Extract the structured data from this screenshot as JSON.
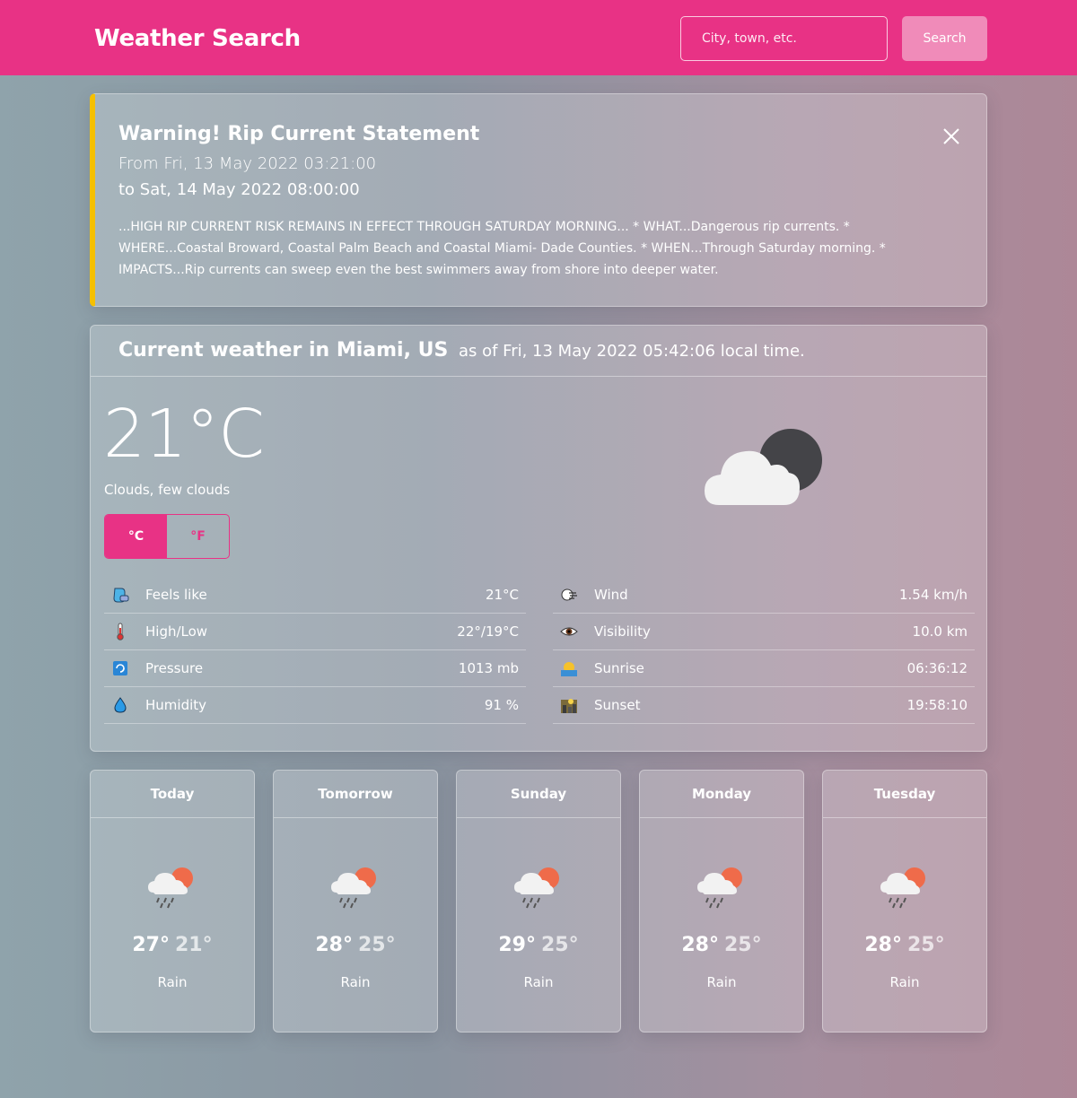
{
  "header": {
    "title": "Weather Search",
    "search_placeholder": "City, town, etc.",
    "search_button": "Search",
    "accent_color": "#e83285"
  },
  "alert": {
    "title": "Warning! Rip Current Statement",
    "from": "From Fri, 13 May 2022 03:21:00",
    "to": "to Sat, 14 May 2022 08:00:00",
    "body": "...HIGH RIP CURRENT RISK REMAINS IN EFFECT THROUGH SATURDAY MORNING... * WHAT...Dangerous rip currents. * WHERE...Coastal Broward, Coastal Palm Beach and Coastal Miami- Dade Counties. * WHEN...Through Saturday morning. * IMPACTS...Rip currents can sweep even the best swimmers away from shore into deeper water.",
    "border_color": "#f5c000",
    "close_icon": "close-icon"
  },
  "current": {
    "title": "Current weather in Miami, US",
    "subtitle": "as of Fri, 13 May 2022 05:42:06 local time.",
    "temperature": "21°C",
    "description": "Clouds, few clouds",
    "unit_c": "°C",
    "unit_f": "°F",
    "selected_unit": "C",
    "icon": "night-cloud-icon",
    "stats_left": [
      {
        "label": "Feels like",
        "value": "21°C",
        "icon": "feels-like-icon"
      },
      {
        "label": "High/Low",
        "value": "22°/19°C",
        "icon": "thermometer-icon"
      },
      {
        "label": "Pressure",
        "value": "1013 mb",
        "icon": "pressure-icon"
      },
      {
        "label": "Humidity",
        "value": "91 %",
        "icon": "droplet-icon"
      }
    ],
    "stats_right": [
      {
        "label": "Wind",
        "value": "1.54 km/h",
        "icon": "wind-icon"
      },
      {
        "label": "Visibility",
        "value": "10.0 km",
        "icon": "eye-icon"
      },
      {
        "label": "Sunrise",
        "value": "06:36:12",
        "icon": "sunrise-icon"
      },
      {
        "label": "Sunset",
        "value": "19:58:10",
        "icon": "sunset-icon"
      }
    ]
  },
  "forecast": [
    {
      "day": "Today",
      "high": "27°",
      "low": "21°",
      "desc": "Rain",
      "icon": "rain-sun-icon"
    },
    {
      "day": "Tomorrow",
      "high": "28°",
      "low": "25°",
      "desc": "Rain",
      "icon": "rain-sun-icon"
    },
    {
      "day": "Sunday",
      "high": "29°",
      "low": "25°",
      "desc": "Rain",
      "icon": "rain-sun-icon"
    },
    {
      "day": "Monday",
      "high": "28°",
      "low": "25°",
      "desc": "Rain",
      "icon": "rain-sun-icon"
    },
    {
      "day": "Tuesday",
      "high": "28°",
      "low": "25°",
      "desc": "Rain",
      "icon": "rain-sun-icon"
    }
  ]
}
